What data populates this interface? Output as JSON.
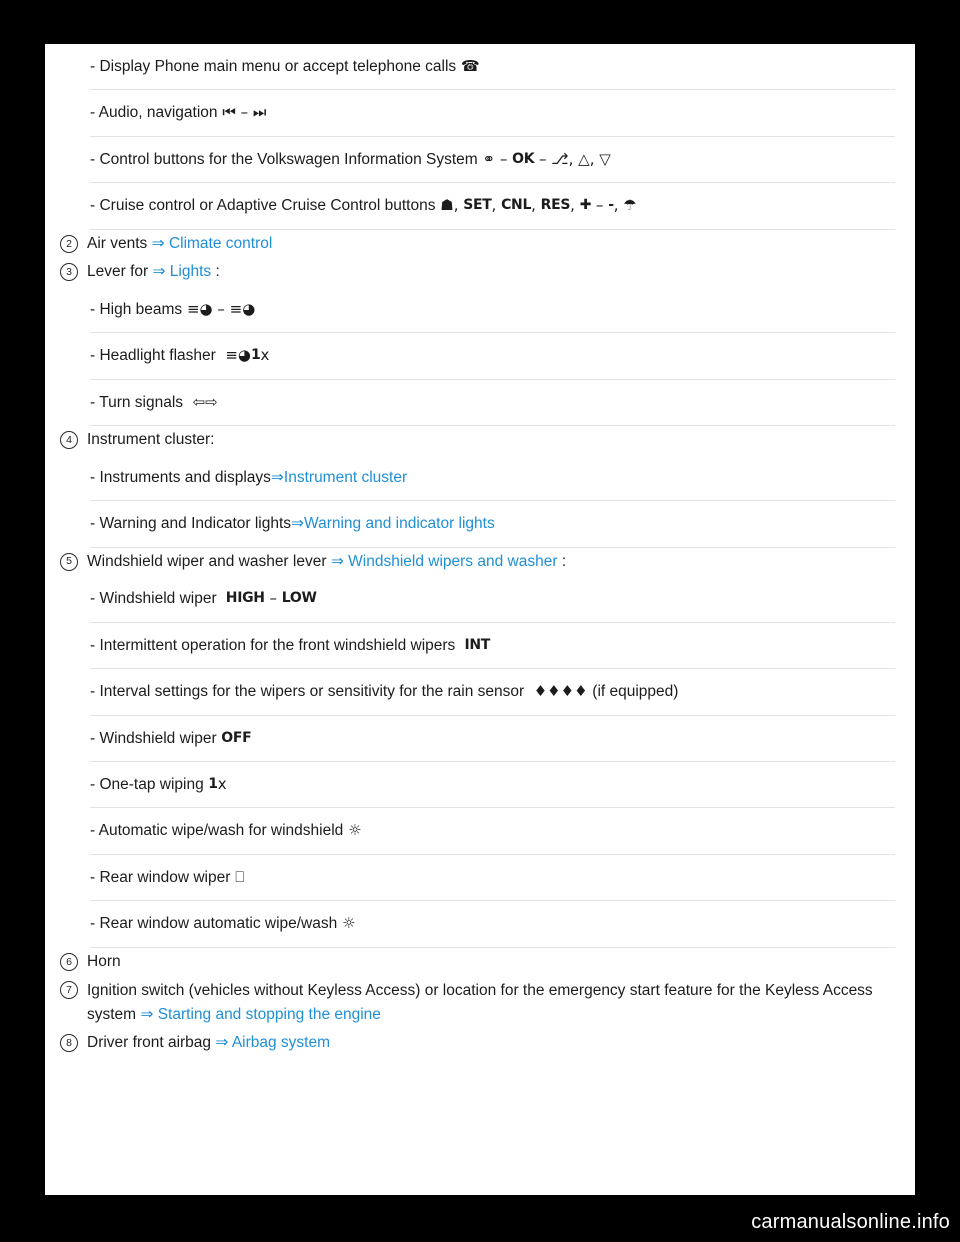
{
  "document": {
    "watermark": "carmanualsonline.info",
    "arrow_glyph": "⇒",
    "rows": [
      {
        "type": "dash",
        "text": "- Display Phone main menu or accept telephone calls",
        "symbols": "✆"
      },
      {
        "type": "dash",
        "text": "- Audio, navigation",
        "symbols": "⏮ – ⏭"
      },
      {
        "type": "dash",
        "text": "- Control buttons for the Volkswagen Information System",
        "symbols": "⛭ – OK – ⎇, △, ▽"
      },
      {
        "type": "dash",
        "text": "- Cruise control or Adaptive Cruise Control buttons",
        "symbols": "♅/ₗ, SET, CNL, RES, ✚ –  -, ☂"
      },
      {
        "type": "num",
        "number": "2",
        "text": "Air vents",
        "link": "Climate control",
        "suffix": ""
      },
      {
        "type": "num",
        "number": "3",
        "text": "Lever for",
        "link": "Lights",
        "suffix": ":"
      },
      {
        "type": "dash",
        "text": "- High beams",
        "symbols": "≡◗ – ≡◗"
      },
      {
        "type": "dash",
        "text": "- Headlight flasher",
        "symbols": "≡◗ 1x"
      },
      {
        "type": "dash",
        "text": "- Turn signals",
        "symbols": "⇦ ⇨"
      },
      {
        "type": "num",
        "number": "4",
        "text": "Instrument cluster:",
        "link": "",
        "suffix": ""
      },
      {
        "type": "dash",
        "text": "- Instruments and displays",
        "link": "Instrument cluster",
        "symbols": ""
      },
      {
        "type": "dash",
        "text": "- Warning and Indicator lights",
        "link": "Warning and indicator lights",
        "symbols": ""
      },
      {
        "type": "num",
        "number": "5",
        "text": "Windshield wiper and washer lever",
        "link": "Windshield wipers and washer",
        "suffix": ":"
      },
      {
        "type": "dash",
        "text": "- Windshield wiper",
        "symbols": "HIGH – LOW"
      },
      {
        "type": "dash",
        "text": "- Intermittent operation for the front windshield wipers",
        "symbols": "INT"
      },
      {
        "type": "dash",
        "text": "- Interval settings for the wipers or sensitivity for the rain sensor",
        "symbols": "▃▃▃▃",
        "trailing": "(if equipped)"
      },
      {
        "type": "dash",
        "text": "- Windshield wiper",
        "symbols": "OFF"
      },
      {
        "type": "dash",
        "text": "- One-tap wiping",
        "symbols": "1x"
      },
      {
        "type": "dash",
        "text": "- Automatic wipe/wash for windshield",
        "symbols": "☂"
      },
      {
        "type": "dash",
        "text": "- Rear window wiper",
        "symbols": "□"
      },
      {
        "type": "dash",
        "text": "- Rear window automatic wipe/wash",
        "symbols": "☂"
      },
      {
        "type": "num",
        "number": "6",
        "text": "Horn",
        "link": "",
        "suffix": ""
      },
      {
        "type": "num",
        "number": "7",
        "text": "Ignition switch (vehicles without Keyless Access) or location for the emergency start feature for the Keyless Access system",
        "link": "Starting and stopping the engine",
        "suffix": ""
      },
      {
        "type": "num",
        "number": "8",
        "text": "Driver front airbag",
        "link": "Airbag system",
        "suffix": ""
      }
    ]
  },
  "text": {
    "r0": "- Display Phone main menu or accept telephone calls",
    "r1": "- Audio, navigation",
    "r2": "- Control buttons for the Volkswagen Information System",
    "r3": "- Cruise control or Adaptive Cruise Control buttons",
    "r4_label": "Air vents",
    "r4_link": "Climate control",
    "r4_num": "2",
    "r5_label": "Lever for",
    "r5_link": "Lights",
    "r5_suffix": ":",
    "r5_num": "3",
    "r6": "- High beams",
    "r7": "- Headlight flasher",
    "r8": "- Turn signals",
    "r9_num": "4",
    "r9_label": "Instrument cluster:",
    "r10": "- Instruments and displays",
    "r10_link": "Instrument cluster",
    "r11": "- Warning and Indicator lights",
    "r11_link": "Warning and indicator lights",
    "r12_num": "5",
    "r12_label": "Windshield wiper and washer lever",
    "r12_link": "Windshield wipers and washer",
    "r12_suffix": ":",
    "r13": "- Windshield wiper",
    "r14": "- Intermittent operation for the front windshield wipers",
    "r15": "- Interval settings for the wipers or sensitivity for the rain sensor",
    "r15_trailing": "(if equipped)",
    "r16": "- Windshield wiper",
    "r17": "- One-tap wiping",
    "r18": "- Automatic wipe/wash for windshield",
    "r19": "- Rear window wiper",
    "r20": "- Rear window automatic wipe/wash",
    "r21_num": "6",
    "r21_label": "Horn",
    "r22_num": "7",
    "r22_label": "Ignition switch (vehicles without Keyless Access) or location for the emergency start feature for the Keyless Access system",
    "r22_link": "Starting and stopping the engine",
    "r23_num": "8",
    "r23_label": "Driver front airbag",
    "r23_link": "Airbag system"
  },
  "colors": {
    "link": "#1f8fd6",
    "text": "#1c1c1c",
    "separator": "#e3e3e3",
    "page_bg": "#ffffff",
    "backdrop": "#000000"
  }
}
